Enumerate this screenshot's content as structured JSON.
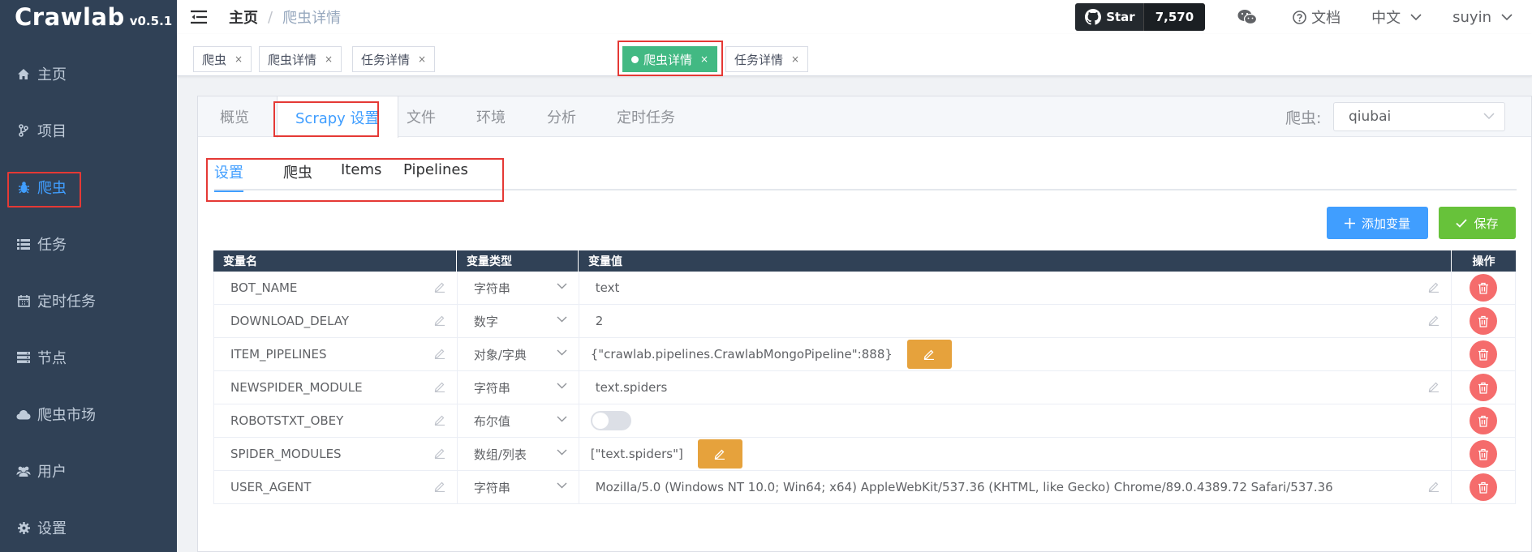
{
  "app": {
    "name": "Crawlab",
    "version": "v0.5.1"
  },
  "sidebar": {
    "items": [
      {
        "label": "主页",
        "icon": "home-icon"
      },
      {
        "label": "项目",
        "icon": "branch-icon"
      },
      {
        "label": "爬虫",
        "icon": "bug-icon",
        "active": true
      },
      {
        "label": "任务",
        "icon": "list-icon"
      },
      {
        "label": "定时任务",
        "icon": "calendar-icon"
      },
      {
        "label": "节点",
        "icon": "server-icon"
      },
      {
        "label": "爬虫市场",
        "icon": "cloud-icon"
      },
      {
        "label": "用户",
        "icon": "users-icon"
      },
      {
        "label": "设置",
        "icon": "gear-icon"
      }
    ]
  },
  "header": {
    "breadcrumb": {
      "home": "主页",
      "current": "爬虫详情"
    },
    "github": {
      "star_label": "Star",
      "count": "7,570"
    },
    "docs_label": "文档",
    "language": "中文",
    "user": "suyin"
  },
  "tags": [
    {
      "label": "爬虫"
    },
    {
      "label": "爬虫详情"
    },
    {
      "label": "任务详情"
    },
    {
      "label": "爬虫详情",
      "active": true
    },
    {
      "label": "任务详情"
    }
  ],
  "tabs": [
    {
      "label": "概览"
    },
    {
      "label": "Scrapy 设置",
      "active": true
    },
    {
      "label": "文件"
    },
    {
      "label": "环境"
    },
    {
      "label": "分析"
    },
    {
      "label": "定时任务"
    }
  ],
  "spider_selector": {
    "label": "爬虫:",
    "value": "qiubai"
  },
  "subtabs": [
    {
      "label": "设置",
      "active": true
    },
    {
      "label": "爬虫"
    },
    {
      "label": "Items"
    },
    {
      "label": "Pipelines"
    }
  ],
  "actions": {
    "add_label": "添加变量",
    "save_label": "保存"
  },
  "table": {
    "headers": [
      "变量名",
      "变量类型",
      "变量值",
      "操作"
    ],
    "rows": [
      {
        "name": "BOT_NAME",
        "type": "字符串",
        "value": "text",
        "kind": "text"
      },
      {
        "name": "DOWNLOAD_DELAY",
        "type": "数字",
        "value": "2",
        "kind": "text"
      },
      {
        "name": "ITEM_PIPELINES",
        "type": "对象/字典",
        "value": "{\"crawlab.pipelines.CrawlabMongoPipeline\":888}",
        "kind": "object"
      },
      {
        "name": "NEWSPIDER_MODULE",
        "type": "字符串",
        "value": "text.spiders",
        "kind": "text"
      },
      {
        "name": "ROBOTSTXT_OBEY",
        "type": "布尔值",
        "value": "",
        "kind": "bool"
      },
      {
        "name": "SPIDER_MODULES",
        "type": "数组/列表",
        "value": "[\"text.spiders\"]",
        "kind": "object"
      },
      {
        "name": "USER_AGENT",
        "type": "字符串",
        "value": "Mozilla/5.0 (Windows NT 10.0; Win64; x64) AppleWebKit/537.36 (KHTML, like Gecko) Chrome/89.0.4389.72 Safari/537.36",
        "kind": "text"
      }
    ]
  },
  "colors": {
    "sidebar_bg": "#304156",
    "accent": "#409eff",
    "success": "#67c23a",
    "warning": "#e6a23c",
    "danger": "#f56c6c",
    "tag_active": "#42b983",
    "highlight": "#e53935"
  }
}
